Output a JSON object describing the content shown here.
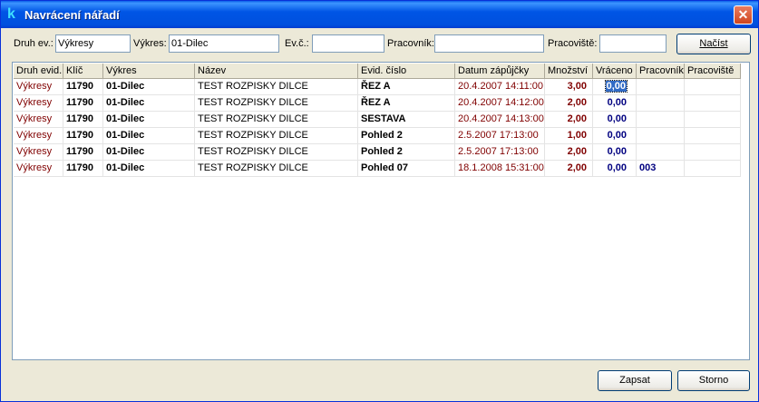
{
  "window": {
    "title": "Navrácení nářadí",
    "icon": "app-k-icon",
    "close_label": "✕"
  },
  "filters": {
    "druh_label": "Druh ev.:",
    "druh_value": "Výkresy",
    "vykres_label": "Výkres:",
    "vykres_value": "01-Dilec",
    "evc_label": "Ev.č.:",
    "evc_value": "",
    "pracovnik_label": "Pracovník:",
    "pracovnik_value": "",
    "pracoviste_label": "Pracoviště:",
    "pracoviste_value": "",
    "load_button": "Načíst"
  },
  "table": {
    "columns": [
      "Druh evid.",
      "Klíč",
      "Výkres",
      "Název",
      "Evid. číslo",
      "Datum zápůjčky",
      "Množství",
      "Vráceno",
      "Pracovník",
      "Pracoviště"
    ],
    "rows": [
      [
        "Výkresy",
        "11790",
        "01-Dilec",
        "TEST ROZPISKY DILCE",
        "ŘEZ A",
        "20.4.2007 14:11:00",
        "3,00",
        "0,00",
        "",
        ""
      ],
      [
        "Výkresy",
        "11790",
        "01-Dilec",
        "TEST ROZPISKY DILCE",
        "ŘEZ A",
        "20.4.2007 14:12:00",
        "2,00",
        "0,00",
        "",
        ""
      ],
      [
        "Výkresy",
        "11790",
        "01-Dilec",
        "TEST ROZPISKY DILCE",
        "SESTAVA",
        "20.4.2007 14:13:00",
        "2,00",
        "0,00",
        "",
        ""
      ],
      [
        "Výkresy",
        "11790",
        "01-Dilec",
        "TEST ROZPISKY DILCE",
        "Pohled 2",
        "2.5.2007 17:13:00",
        "1,00",
        "0,00",
        "",
        ""
      ],
      [
        "Výkresy",
        "11790",
        "01-Dilec",
        "TEST ROZPISKY DILCE",
        "Pohled 2",
        "2.5.2007 17:13:00",
        "2,00",
        "0,00",
        "",
        ""
      ],
      [
        "Výkresy",
        "11790",
        "01-Dilec",
        "TEST ROZPISKY DILCE",
        "Pohled 07",
        "18.1.2008 15:31:00",
        "2,00",
        "0,00",
        "003",
        ""
      ]
    ]
  },
  "footer": {
    "save_button": "Zapsat",
    "cancel_button": "Storno"
  }
}
